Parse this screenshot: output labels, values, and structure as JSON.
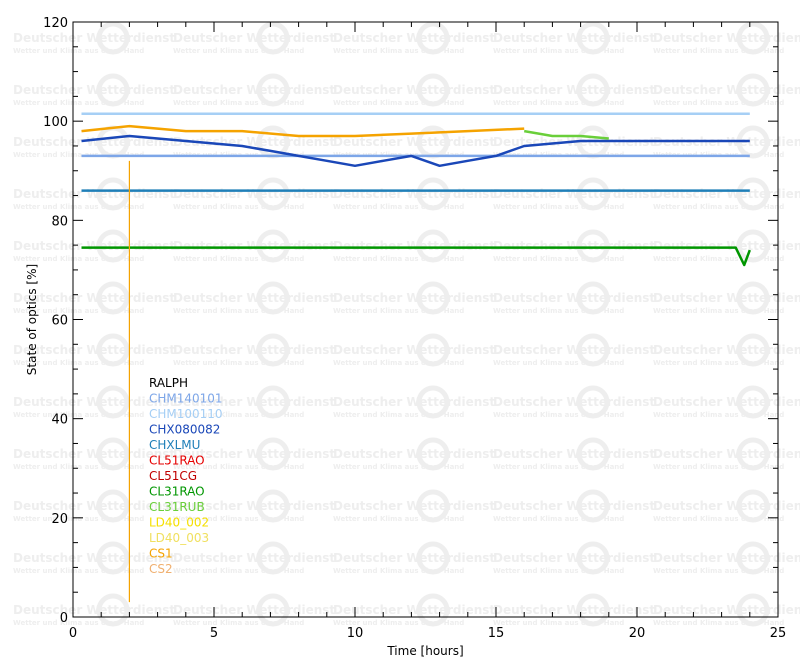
{
  "chart_data": {
    "type": "line",
    "title": "",
    "xlabel": "Time [hours]",
    "ylabel": "State of optics [%]",
    "xlim": [
      0,
      25
    ],
    "ylim": [
      0,
      120
    ],
    "xticks": [
      0,
      5,
      10,
      15,
      20,
      25
    ],
    "yticks": [
      0,
      20,
      40,
      60,
      80,
      100,
      120
    ],
    "grid": false,
    "legend_placement": "center-left",
    "watermark": {
      "line1": "Deutscher Wetterdienst",
      "line2": "Wetter und Klima aus einer Hand",
      "logo": "DWD"
    },
    "series": [
      {
        "name": "RALPH",
        "color": "#000000",
        "points": []
      },
      {
        "name": "CHM140101",
        "color": "#7da6e8",
        "points": [
          [
            0.3,
            93
          ],
          [
            2,
            93
          ],
          [
            5,
            93
          ],
          [
            8,
            93
          ],
          [
            12,
            93
          ],
          [
            16,
            93
          ],
          [
            20,
            93
          ],
          [
            24,
            93
          ]
        ]
      },
      {
        "name": "CHM100110",
        "color": "#a6cff5",
        "points": [
          [
            0.3,
            101.5
          ],
          [
            5,
            101.5
          ],
          [
            10,
            101.5
          ],
          [
            15,
            101.5
          ],
          [
            20,
            101.5
          ],
          [
            24,
            101.5
          ]
        ]
      },
      {
        "name": "CHX080082",
        "color": "#1a47b8",
        "points": [
          [
            0.3,
            96
          ],
          [
            2,
            97
          ],
          [
            4,
            96
          ],
          [
            6,
            95
          ],
          [
            7,
            94
          ],
          [
            8,
            93
          ],
          [
            9,
            92
          ],
          [
            10,
            91
          ],
          [
            11,
            92
          ],
          [
            12,
            93
          ],
          [
            13,
            91
          ],
          [
            14,
            92
          ],
          [
            15,
            93
          ],
          [
            16,
            95
          ],
          [
            18,
            96
          ],
          [
            20,
            96
          ],
          [
            22,
            96
          ],
          [
            24,
            96
          ]
        ]
      },
      {
        "name": "CHXLMU",
        "color": "#1f7fb8",
        "points": [
          [
            0.3,
            86
          ],
          [
            5,
            86
          ],
          [
            10,
            86
          ],
          [
            15,
            86
          ],
          [
            20,
            86
          ],
          [
            24,
            86
          ]
        ]
      },
      {
        "name": "CL51RAO",
        "color": "#e60000",
        "points": []
      },
      {
        "name": "CL51CG",
        "color": "#c00000",
        "points": []
      },
      {
        "name": "CL31RAO",
        "color": "#009600",
        "points": [
          [
            0.3,
            74.5
          ],
          [
            5,
            74.5
          ],
          [
            10,
            74.5
          ],
          [
            15,
            74.5
          ],
          [
            20,
            74.5
          ],
          [
            23.5,
            74.5
          ],
          [
            23.8,
            71
          ],
          [
            24,
            74
          ]
        ]
      },
      {
        "name": "CL31RUB",
        "color": "#6acf3a",
        "points": [
          [
            16,
            98
          ],
          [
            17,
            97
          ],
          [
            18,
            97
          ],
          [
            19,
            96.5
          ]
        ]
      },
      {
        "name": "LD40_002",
        "color": "#f5e000",
        "points": []
      },
      {
        "name": "LD40_003",
        "color": "#f0e060",
        "points": []
      },
      {
        "name": "CS1",
        "color": "#f5a300",
        "points": [
          [
            0.3,
            98
          ],
          [
            2,
            99
          ],
          [
            4,
            98
          ],
          [
            6,
            98
          ],
          [
            8,
            97
          ],
          [
            10,
            97
          ],
          [
            12,
            97.5
          ],
          [
            14,
            98
          ],
          [
            16,
            98.5
          ]
        ]
      },
      {
        "name": "CS2",
        "color": "#f0b070",
        "points": []
      }
    ],
    "annotations": [
      {
        "type": "vertical-line",
        "x": 2,
        "y_range": [
          3,
          92
        ],
        "color": "#f5a300"
      }
    ]
  }
}
